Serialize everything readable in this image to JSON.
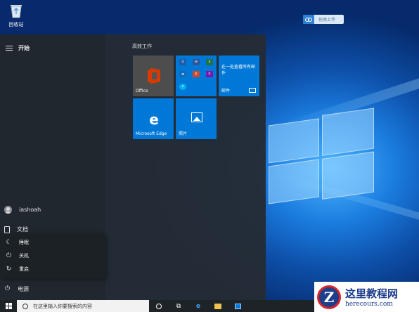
{
  "desktop": {
    "recycle_bin_label": "回收站",
    "cloud_button_label": "拖拽上传"
  },
  "start_menu": {
    "title": "开始",
    "user_name": "iashoah",
    "documents_label": "文档",
    "power_label": "电源",
    "power_options": [
      {
        "label": "睡眠",
        "icon": "moon-icon"
      },
      {
        "label": "关机",
        "icon": "power-icon"
      },
      {
        "label": "重启",
        "icon": "restart-icon"
      }
    ],
    "group_title": "高效工作",
    "tiles": {
      "office": "Office",
      "mail_caption": "在一处查看所有邮件",
      "mail": "邮件",
      "edge": "Microsoft Edge",
      "photos": "照片"
    },
    "colors": {
      "tile_blue": "#0078d7",
      "office_tile": "#4d4d4d"
    }
  },
  "taskbar": {
    "search_placeholder": "在这里输入你要搜索的内容"
  },
  "watermark": {
    "title": "这里教程网",
    "url": "herecours.com"
  }
}
